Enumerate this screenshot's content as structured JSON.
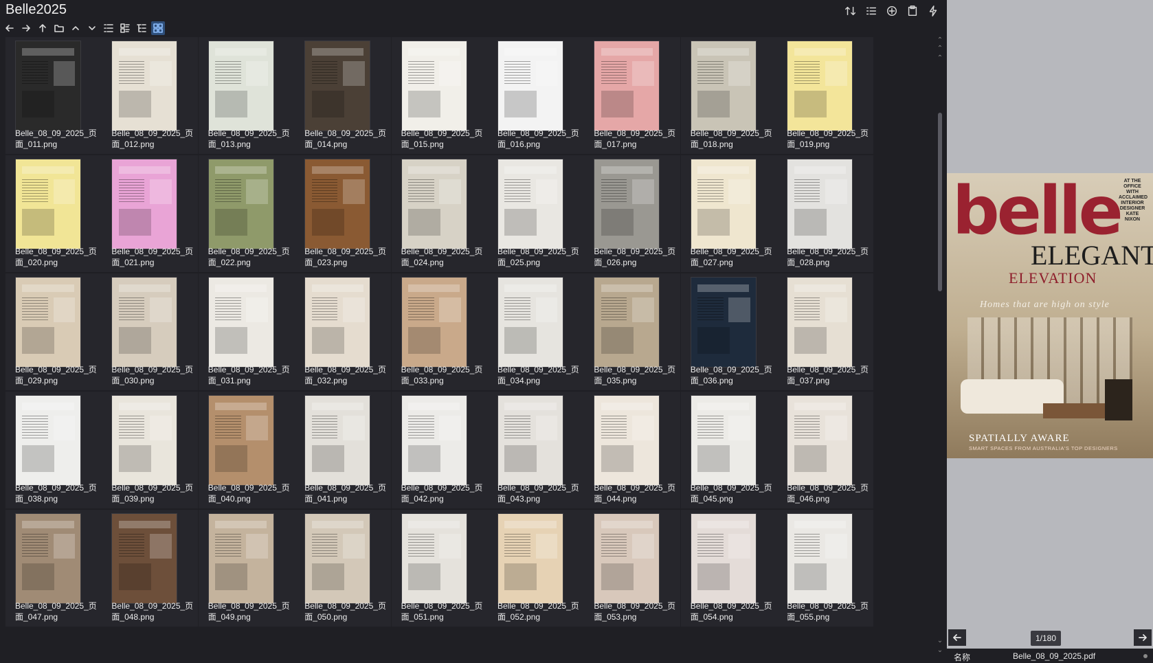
{
  "window": {
    "title": "Belle2025"
  },
  "top_tools": [
    {
      "name": "sort-icon"
    },
    {
      "name": "list-view-icon"
    },
    {
      "name": "add-circle-icon"
    },
    {
      "name": "clipboard-icon"
    },
    {
      "name": "flash-icon"
    }
  ],
  "nav_tools": [
    {
      "name": "back-arrow-icon"
    },
    {
      "name": "forward-arrow-icon"
    },
    {
      "name": "up-arrow-icon"
    },
    {
      "name": "folder-open-icon"
    },
    {
      "name": "chevron-up-icon"
    },
    {
      "name": "chevron-down-icon"
    },
    {
      "name": "details-view-icon"
    },
    {
      "name": "tiles-view-icon"
    },
    {
      "name": "tree-view-icon"
    },
    {
      "name": "thumbnails-view-icon"
    }
  ],
  "files": {
    "prefix": "Belle_08_09_2025_页面_",
    "ext": ".png",
    "items": [
      {
        "n": "011",
        "c": "#2a2a2a"
      },
      {
        "n": "012",
        "c": "#e6e0d4"
      },
      {
        "n": "013",
        "c": "#dfe3d9"
      },
      {
        "n": "014",
        "c": "#4b4036"
      },
      {
        "n": "015",
        "c": "#f1efe9"
      },
      {
        "n": "016",
        "c": "#f3f3f3"
      },
      {
        "n": "017",
        "c": "#e5a7a7"
      },
      {
        "n": "018",
        "c": "#c9c4b6"
      },
      {
        "n": "019",
        "c": "#f3e59a"
      },
      {
        "n": "020",
        "c": "#f1e596"
      },
      {
        "n": "021",
        "c": "#e9a4d6"
      },
      {
        "n": "022",
        "c": "#8f9a6a"
      },
      {
        "n": "023",
        "c": "#8a5a33"
      },
      {
        "n": "024",
        "c": "#d7d2c6"
      },
      {
        "n": "025",
        "c": "#e9e7e2"
      },
      {
        "n": "026",
        "c": "#9a9892"
      },
      {
        "n": "027",
        "c": "#efe6cf"
      },
      {
        "n": "028",
        "c": "#e3e2df"
      },
      {
        "n": "029",
        "c": "#d9cbb5"
      },
      {
        "n": "030",
        "c": "#d6ccbd"
      },
      {
        "n": "031",
        "c": "#ece9e3"
      },
      {
        "n": "032",
        "c": "#e5dccf"
      },
      {
        "n": "033",
        "c": "#c9a98a"
      },
      {
        "n": "034",
        "c": "#e6e4df"
      },
      {
        "n": "035",
        "c": "#b8a88f"
      },
      {
        "n": "036",
        "c": "#1e2b3c"
      },
      {
        "n": "037",
        "c": "#e6dfd3"
      },
      {
        "n": "038",
        "c": "#eeeeec"
      },
      {
        "n": "039",
        "c": "#e9e5dc"
      },
      {
        "n": "040",
        "c": "#b48f6c"
      },
      {
        "n": "041",
        "c": "#e3e0da"
      },
      {
        "n": "042",
        "c": "#ecebe8"
      },
      {
        "n": "043",
        "c": "#e4e1dc"
      },
      {
        "n": "044",
        "c": "#ede6dc"
      },
      {
        "n": "045",
        "c": "#ecebe7"
      },
      {
        "n": "046",
        "c": "#e8e2da"
      },
      {
        "n": "047",
        "c": "#a08b75"
      },
      {
        "n": "048",
        "c": "#6d4f3a"
      },
      {
        "n": "049",
        "c": "#c4b39d"
      },
      {
        "n": "050",
        "c": "#d3c8b8"
      },
      {
        "n": "051",
        "c": "#e5e2dc"
      },
      {
        "n": "052",
        "c": "#e6d2b4"
      },
      {
        "n": "053",
        "c": "#d8c8bb"
      },
      {
        "n": "054",
        "c": "#e4dcd8"
      },
      {
        "n": "055",
        "c": "#eae8e4"
      }
    ]
  },
  "preview": {
    "cover": {
      "logo": "belle",
      "headline": "ELEGANT",
      "headline2": "ELEVATION",
      "tagline": "Homes that are high on style",
      "side_text": "AT THE OFFICE WITH ACCLAIMED INTERIOR DESIGNER KATE NIXON",
      "footer_title": "SPATIALLY AWARE",
      "footer_sub": "SMART SPACES FROM AUSTRALIA'S TOP DESIGNERS"
    },
    "page_counter": "1/180"
  },
  "status": {
    "name_label": "名称",
    "name_value": "Belle_08_09_2025.pdf"
  }
}
